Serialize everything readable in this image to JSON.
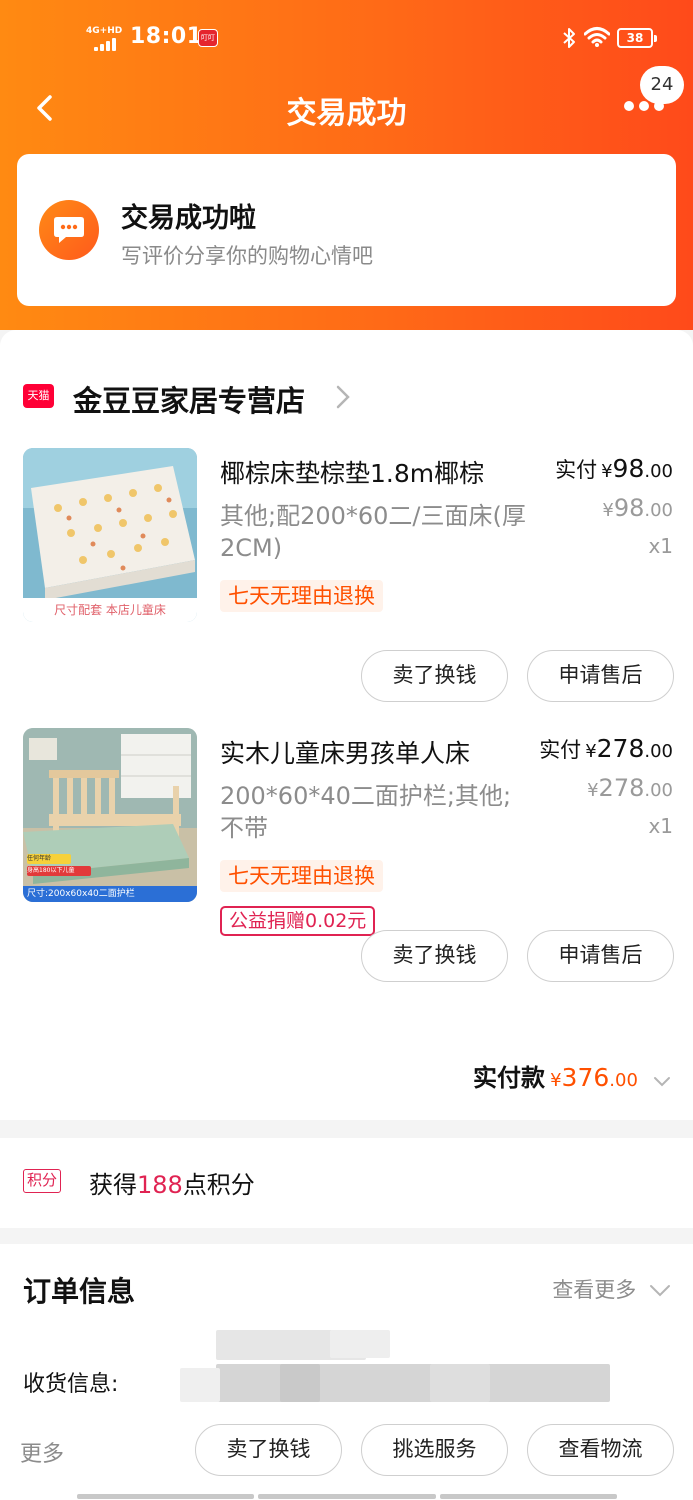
{
  "status_bar": {
    "network": "4G+HD",
    "time": "18:01",
    "app_badge": "叮叮",
    "battery": "38"
  },
  "nav": {
    "title": "交易成功",
    "badge_count": "24"
  },
  "success_card": {
    "title": "交易成功啦",
    "subtitle": "写评价分享你的购物心情吧"
  },
  "store": {
    "platform_tag": "天猫",
    "name": "金豆豆家居专营店"
  },
  "items": [
    {
      "title": "椰棕床垫棕垫1.8m椰棕",
      "spec": "其他;配200*60二/三面床(厚2CM)",
      "paid_label": "实付",
      "paid_currency": "¥",
      "paid_int": "98",
      "paid_dec": ".00",
      "orig_currency": "¥",
      "orig_int": "98",
      "orig_dec": ".00",
      "qty": "x1",
      "return_tag": "七天无理由退换",
      "thumb_caption": "尺寸配套 本店儿童床",
      "sell_button": "卖了换钱",
      "after_sale_button": "申请售后"
    },
    {
      "title": "实木儿童床男孩单人床",
      "spec": "200*60*40二面护栏;其他;不带",
      "paid_label": "实付",
      "paid_currency": "¥",
      "paid_int": "278",
      "paid_dec": ".00",
      "orig_currency": "¥",
      "orig_int": "278",
      "orig_dec": ".00",
      "qty": "x1",
      "return_tag": "七天无理由退换",
      "charity_tag": "公益捐赠0.02元",
      "thumb_caption": "尺寸:200x60x40二面护栏",
      "thumb_sticker_1": "任何年龄",
      "thumb_sticker_2": "身高180以下儿童",
      "sell_button": "卖了换钱",
      "after_sale_button": "申请售后"
    }
  ],
  "total": {
    "label": "实付款",
    "currency": "¥",
    "int": "376",
    "dec": ".00"
  },
  "points": {
    "icon_text": "积分",
    "prefix": "获得",
    "amount": "188",
    "suffix": "点积分"
  },
  "order_info": {
    "title": "订单信息",
    "view_more": "查看更多",
    "shipping_label": "收货信息:"
  },
  "bottom_bar": {
    "more": "更多",
    "sell": "卖了换钱",
    "service": "挑选服务",
    "logistics": "查看物流"
  },
  "colors": {
    "header_start": "#ff8a12",
    "header_end": "#ff4a1a",
    "price_accent": "#ff5000",
    "tmall_red": "#ff0036",
    "charity_red": "#e02352"
  },
  "icons": {
    "back": "back-arrow-icon",
    "more": "more-dots-icon",
    "chat": "chat-bubble-icon",
    "chevron_right": "chevron-right-icon",
    "chevron_down": "chevron-down-icon",
    "bluetooth": "bluetooth-icon",
    "wifi": "wifi-icon"
  }
}
